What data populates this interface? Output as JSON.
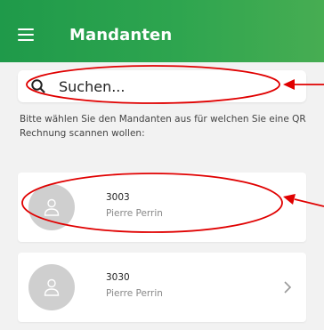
{
  "header": {
    "title": "Mandanten",
    "menu_icon": "hamburger-menu-icon"
  },
  "search": {
    "placeholder": "Suchen...",
    "value": "",
    "icon": "search-icon"
  },
  "instruction_text": "Bitte wählen Sie den Mandanten aus für welchen Sie eine QR Rechnung scannen wollen:",
  "clients": [
    {
      "number": "3003",
      "name": "Pierre Perrin",
      "icon": "person-icon"
    },
    {
      "number": "3030",
      "name": "Pierre Perrin",
      "icon": "person-icon"
    }
  ],
  "colors": {
    "header_green": "#2ea54f",
    "annotation_red": "#e00000",
    "avatar_grey": "#cfcfcf"
  }
}
